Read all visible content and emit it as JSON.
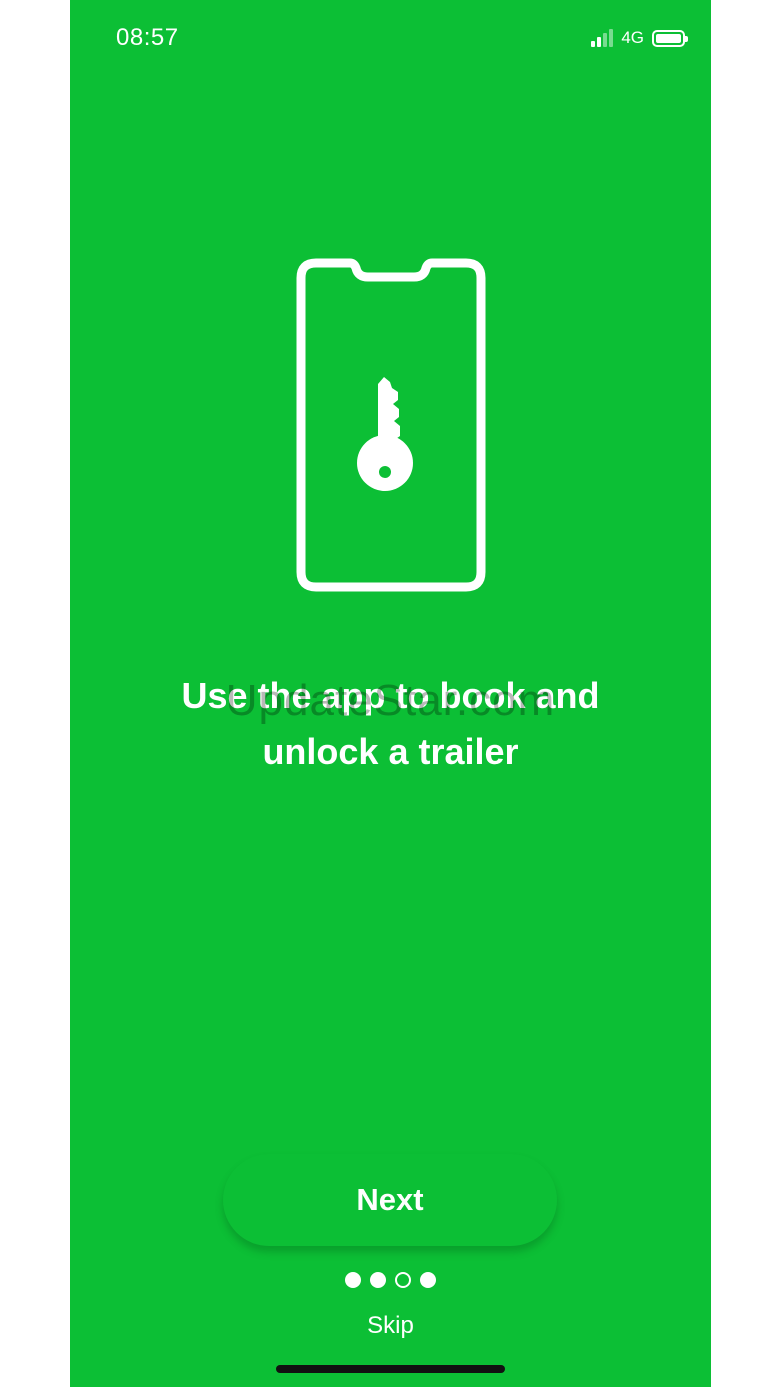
{
  "status_bar": {
    "time": "08:57",
    "network": "4G",
    "signal_bars": 2,
    "signal_bars_total": 4,
    "battery_level": 1.0
  },
  "onboarding": {
    "illustration": "phone-with-key-icon",
    "headline": "Use the app to book and unlock a trailer",
    "watermark": "UpdateStar.com",
    "next_label": "Next",
    "skip_label": "Skip",
    "pages_total": 4,
    "current_page": 3
  },
  "colors": {
    "background": "#0cbf35",
    "foreground": "#ffffff"
  }
}
